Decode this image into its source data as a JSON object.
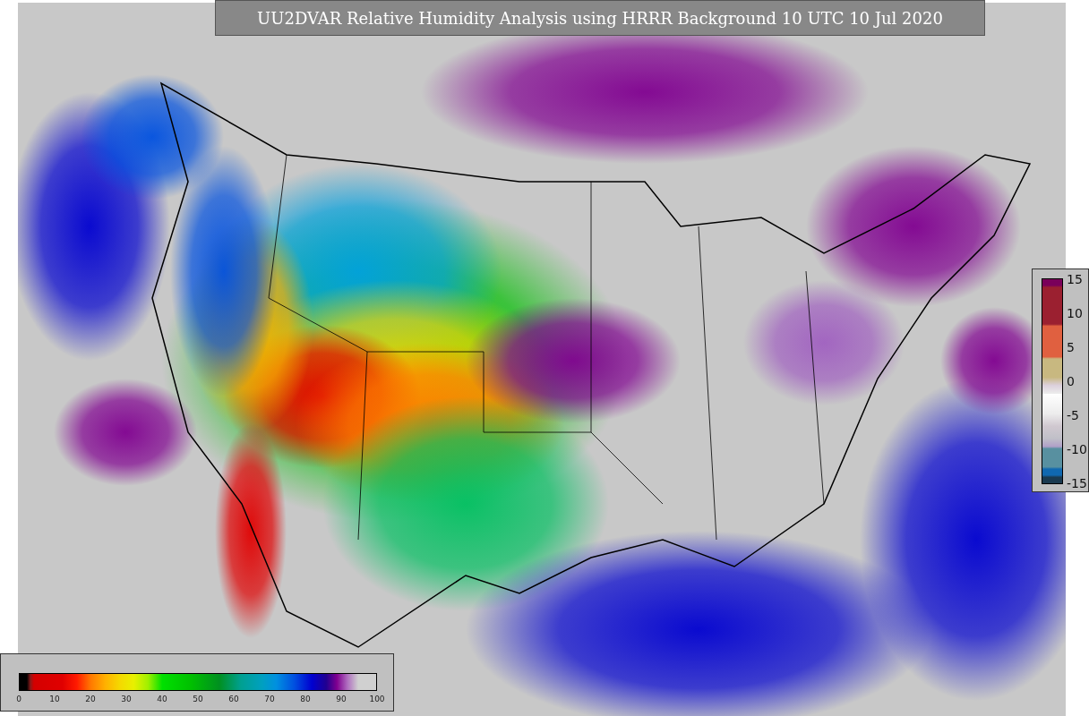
{
  "title": "UU2DVAR Relative Humidity Analysis using HRRR Background 10 UTC 10 Jul 2020",
  "humidity_colorbar": {
    "ticks": [
      "0",
      "10",
      "20",
      "30",
      "40",
      "50",
      "60",
      "70",
      "80",
      "90",
      "100"
    ]
  },
  "difference_colorbar": {
    "ticks": [
      "15",
      "10",
      "5",
      "0",
      "-5",
      "-10",
      "-15"
    ]
  }
}
